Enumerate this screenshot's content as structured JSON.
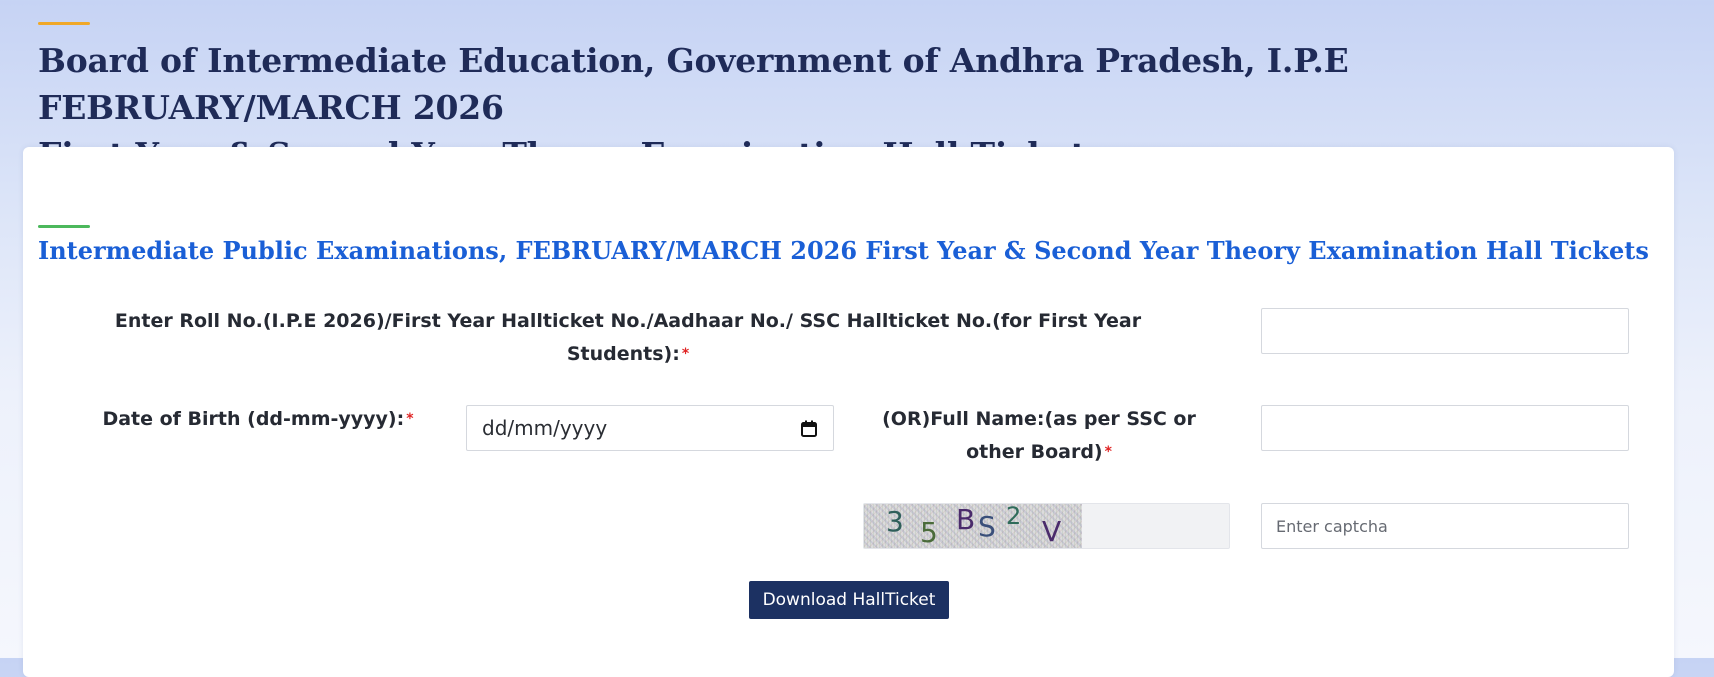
{
  "header": {
    "title_line1": "Board of Intermediate Education, Government of Andhra Pradesh, I.P.E FEBRUARY/MARCH 2026",
    "title_line2": "First Year & Second Year Theory Examination Hall Tickets",
    "accent_color": "#f0a828"
  },
  "form": {
    "section_title": "Intermediate Public Examinations, FEBRUARY/MARCH 2026 First Year & Second Year Theory Examination Hall Tickets",
    "section_accent_color": "#4cb85c",
    "roll_no": {
      "label_line1": "Enter Roll No.(I.P.E 2026)/First Year Hallticket No./Aadhaar No./ SSC Hallticket No.(for First Year",
      "label_line2": "Students):",
      "required_mark": "*",
      "value": ""
    },
    "dob": {
      "label": "Date of Birth (dd-mm-yyyy):",
      "required_mark": "*",
      "value": "dd/mm/yyyy",
      "icon": "calendar-icon"
    },
    "full_name": {
      "label_line1": "(OR)Full Name:(as per SSC or",
      "label_line2": "other Board)",
      "required_mark": "*",
      "value": ""
    },
    "captcha": {
      "chars": [
        "3",
        "5",
        "B",
        "S",
        "2",
        "V"
      ],
      "input_placeholder": "Enter captcha",
      "input_value": ""
    },
    "download_button_label": "Download HallTicket",
    "button_color": "#1c3162"
  }
}
